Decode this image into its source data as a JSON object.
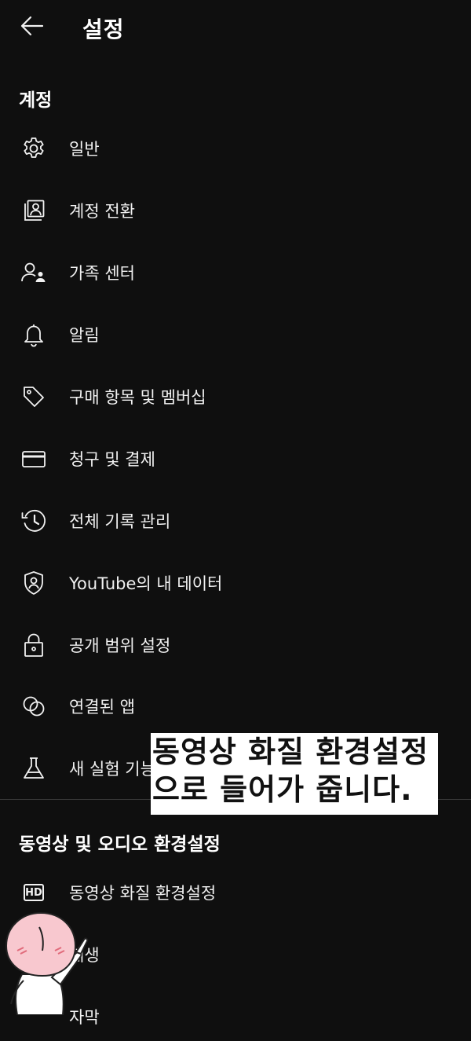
{
  "header": {
    "title": "설정"
  },
  "sections": [
    {
      "title": "계정",
      "items": [
        {
          "label": "일반",
          "icon": "gear-icon"
        },
        {
          "label": "계정 전환",
          "icon": "switch-account-icon"
        },
        {
          "label": "가족 센터",
          "icon": "family-icon"
        },
        {
          "label": "알림",
          "icon": "bell-icon"
        },
        {
          "label": "구매 항목 및 멤버십",
          "icon": "tag-icon"
        },
        {
          "label": "청구 및 결제",
          "icon": "credit-card-icon"
        },
        {
          "label": "전체 기록 관리",
          "icon": "history-icon"
        },
        {
          "label": "YouTube의 내 데이터",
          "icon": "shield-user-icon"
        },
        {
          "label": "공개 범위 설정",
          "icon": "lock-icon"
        },
        {
          "label": "연결된 앱",
          "icon": "linked-apps-icon"
        },
        {
          "label": "새 실험 기능",
          "icon": "flask-icon"
        }
      ]
    },
    {
      "title": "동영상 및 오디오 환경설정",
      "items": [
        {
          "label": "동영상 화질 환경설정",
          "icon": "hd-icon"
        },
        {
          "label": "재생",
          "icon": "playback-icon"
        },
        {
          "label": "자막",
          "icon": "captions-icon"
        }
      ]
    }
  ],
  "hd_badge": "HD",
  "tooltip": {
    "line1": "동영상 화질 환경설정",
    "line2": "으로 들어가 줍니다."
  }
}
